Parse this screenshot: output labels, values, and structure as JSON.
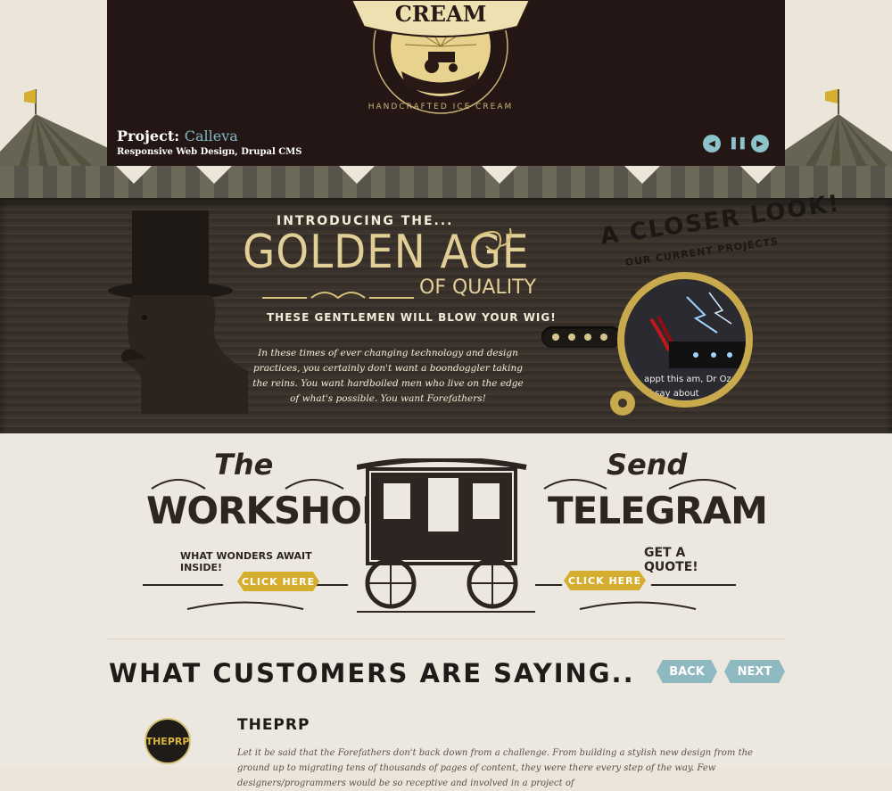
{
  "slider": {
    "logo_word": "CREAM",
    "logo_tagline": "HANDCRAFTED ICE CREAM",
    "project_prefix": "Project:",
    "project_name": "Calleva",
    "project_sub": "Responsive Web Design, Drupal CMS",
    "controls": {
      "prev_icon": "play-left-icon",
      "pause_icon": "pause-icon",
      "next_icon": "play-right-icon"
    }
  },
  "hero": {
    "intro": "INTRODUCING THE...",
    "headline": "GOLDEN AGE",
    "headline_sub": "OF QUALITY",
    "tagline": "THESE GENTLEMEN WILL BLOW YOUR WIG!",
    "paragraph": "In these times of ever changing technology and design practices, you certainly don't want a boondoggler taking the reins. You want hardboiled men who live on the edge of what's possible. You want Forefathers!",
    "closer": "A CLOSER LOOK!",
    "closer_sub": "OUR CURRENT PROJECTS",
    "lens_text_1": "appt this am, Dr Oz",
    "lens_text_2": "ld say about"
  },
  "workshop": {
    "small": "The",
    "big": "WORKSHOP",
    "sub": "WHAT WONDERS AWAIT INSIDE!",
    "cta": "CLICK HERE"
  },
  "telegram": {
    "small": "Send",
    "big": "TELEGRAM",
    "sub": "GET A QUOTE!",
    "cta": "CLICK HERE"
  },
  "testimonials": {
    "title": "WHAT CUSTOMERS ARE SAYING..",
    "back": "BACK",
    "next": "NEXT",
    "client": "THEPRP",
    "avatar_text": "THEPRP",
    "quote": "Let it be said that the Forefathers don't back down from a challenge. From building a stylish new design from the ground up to migrating tens of thousands of pages of content, they were there every step of the way. Few designers/programmers would be so receptive and involved in a project of"
  },
  "colors": {
    "accent_teal": "#8cc2c9",
    "gold": "#d5ad2f",
    "dark_brown": "#241614"
  }
}
